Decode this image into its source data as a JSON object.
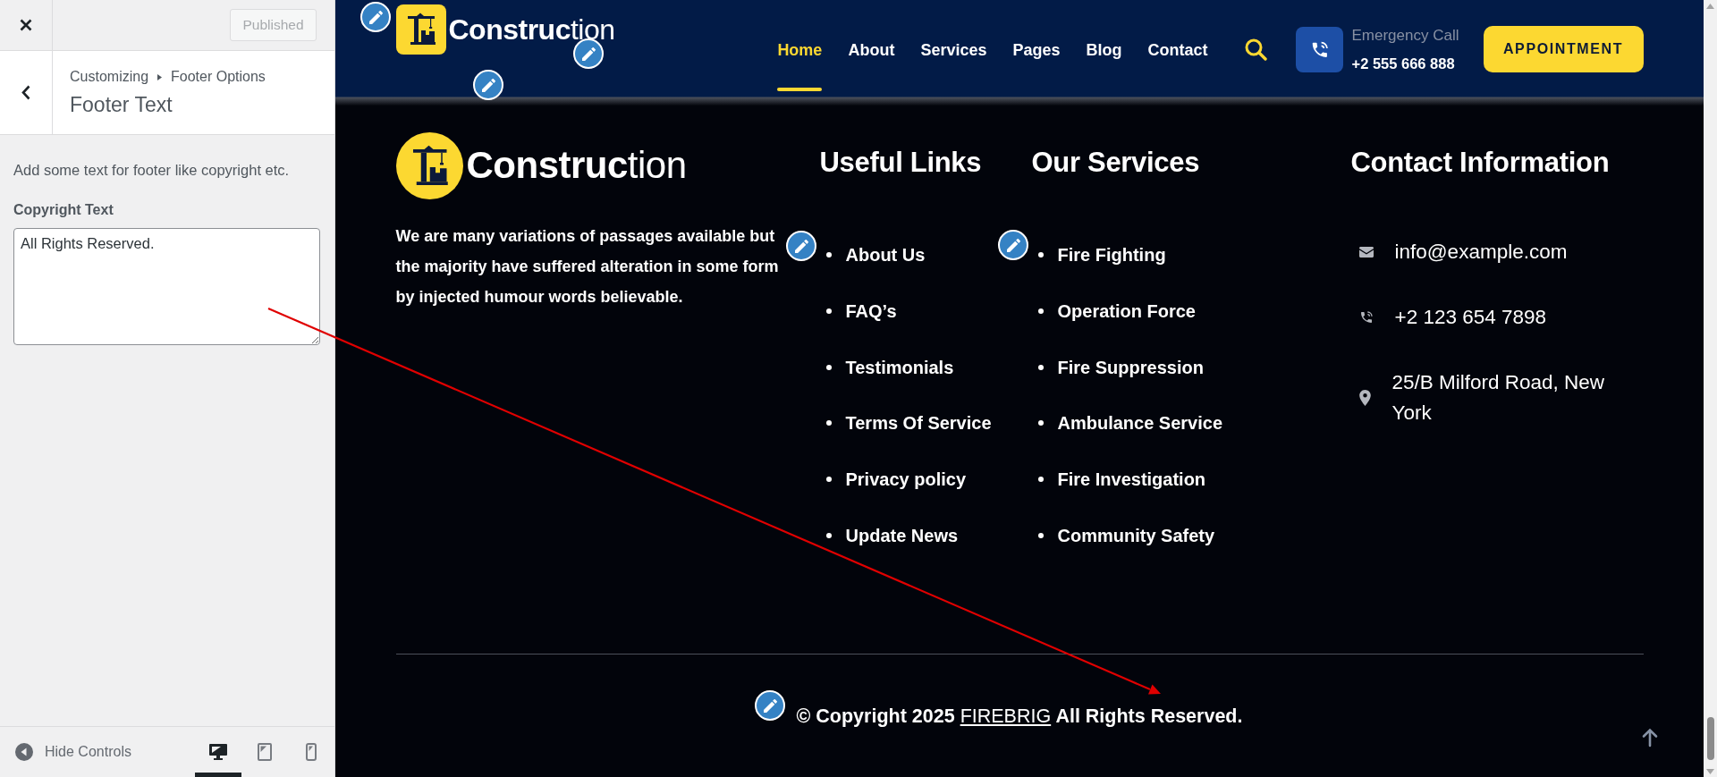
{
  "customizer": {
    "publish_button": {
      "label": "Published",
      "disabled": true
    },
    "breadcrumb": [
      "Customizing",
      "Footer Options"
    ],
    "title": "Footer Text",
    "description": "Add some text for footer like copyright etc.",
    "field": {
      "label": "Copyright Text",
      "value": "All Rights Reserved."
    },
    "hide_controls": "Hide Controls",
    "devices": [
      {
        "kind": "desktop",
        "selected": true
      },
      {
        "kind": "tablet",
        "selected": false
      },
      {
        "kind": "mobile",
        "selected": false
      }
    ]
  },
  "site_header": {
    "logo": "**Construc**tion",
    "nav": [
      {
        "label": "Home",
        "selected": true
      },
      {
        "label": "About",
        "selected": false
      },
      {
        "label": "Services",
        "selected": false
      },
      {
        "label": "Pages",
        "selected": false
      },
      {
        "label": "Blog",
        "selected": false
      },
      {
        "label": "Contact",
        "selected": false
      }
    ],
    "emergency": {
      "label": "Emergency Call",
      "phone": "+2 555 666 888"
    },
    "cta": "APPOINTMENT"
  },
  "footer": {
    "logo": "**Construc**tion",
    "about": "We are many variations of passages available but the majority have suffered alteration in some form by injected humour words believable.",
    "link_columns": [
      {
        "title": "Useful Links",
        "items": [
          "About Us",
          "FAQ’s",
          "Testimonials",
          "Terms Of Service",
          "Privacy policy",
          "Update News"
        ]
      },
      {
        "title": "Our Services",
        "items": [
          "Fire Fighting",
          "Operation Force",
          "Fire Suppression",
          "Ambulance Service",
          "Fire Investigation",
          "Community Safety"
        ]
      }
    ],
    "contact": {
      "title": "Contact Information",
      "items": [
        {
          "kind": "email",
          "text": "info@example.com"
        },
        {
          "kind": "phone",
          "text": "+2 123 654 7898"
        },
        {
          "kind": "address",
          "text": "25/B Milford Road, New York"
        }
      ]
    },
    "copyright": {
      "before": "© Copyright 2025",
      "link": "FIREBRIG",
      "after": "All Rights Reserved."
    }
  }
}
